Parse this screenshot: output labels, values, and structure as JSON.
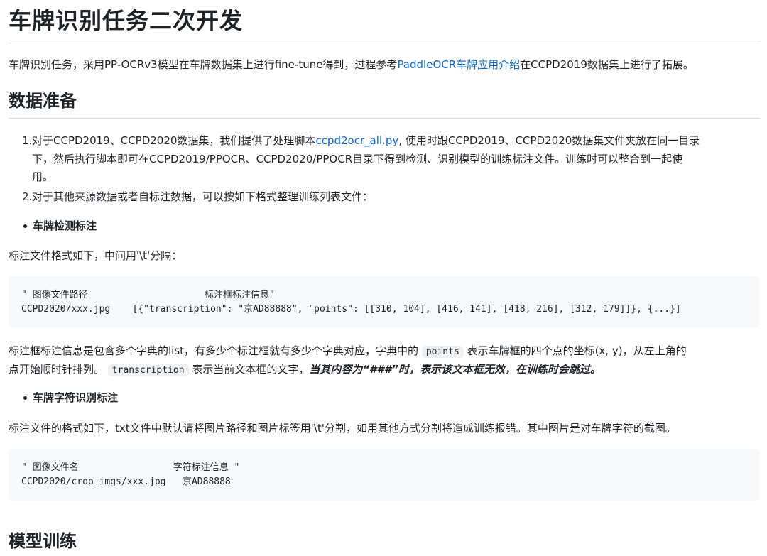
{
  "title": "车牌识别任务二次开发",
  "intro": {
    "text1": "车牌识别任务，采用PP-OCRv3模型在车牌数据集上进行fine-tune得到，过程参考",
    "link": "PaddleOCR车牌应用介绍",
    "text2": "在CCPD2019数据集上进行了拓展。"
  },
  "section_data": {
    "heading": "数据准备",
    "item1": {
      "number": "1.",
      "line1a": "对于CCPD2019、CCPD2020数据集，我们提供了处理脚本",
      "link": "ccpd2ocr_all.py",
      "line1b": ", 使用时跟CCPD2019、CCPD2020数据集文件夹放在同一目录",
      "line2": "下，然后执行脚本即可在CCPD2019/PPOCR、CCPD2020/PPOCR目录下得到检测、识别模型的训练标注文件。训练时可以整合到一起使",
      "line3": "用。"
    },
    "item2": {
      "number": "2.",
      "text": "对于其他来源数据或者自标注数据，可以按如下格式整理训练列表文件："
    }
  },
  "det": {
    "bullet": "车牌检测标注",
    "desc": "标注文件格式如下，中间用'\\t'分隔：",
    "code_line1": "\" 图像文件路径                     标注框标注信息\"",
    "code_line2": "CCPD2020/xxx.jpg    [{\"transcription\": \"京AD88888\", \"points\": [[310, 104], [416, 141], [418, 216], [312, 179]]}, {...}]",
    "para_a": "标注框标注信息是包含多个字典的list，有多少个标注框就有多少个字典对应，字典中的",
    "code_points": "points",
    "para_b": "表示车牌框的四个点的坐标(x, y)，从左上角的",
    "para_c": "点开始顺时针排列。",
    "code_transcription": "transcription",
    "para_d": "表示当前文本框的文字，",
    "para_e": "当其内容为“###”时，表示该文本框无效，在训练时会跳过。"
  },
  "rec": {
    "bullet": "车牌字符识别标注",
    "desc": "标注文件的格式如下，txt文件中默认请将图片路径和图片标签用'\\t'分割，如用其他方式分割将造成训练报错。其中图片是对车牌字符的截图。",
    "code_line1": "\" 图像文件名                 字符标注信息 \"",
    "code_line2": "CCPD2020/crop_imgs/xxx.jpg   京AD88888"
  },
  "section_train": {
    "heading": "模型训练"
  }
}
